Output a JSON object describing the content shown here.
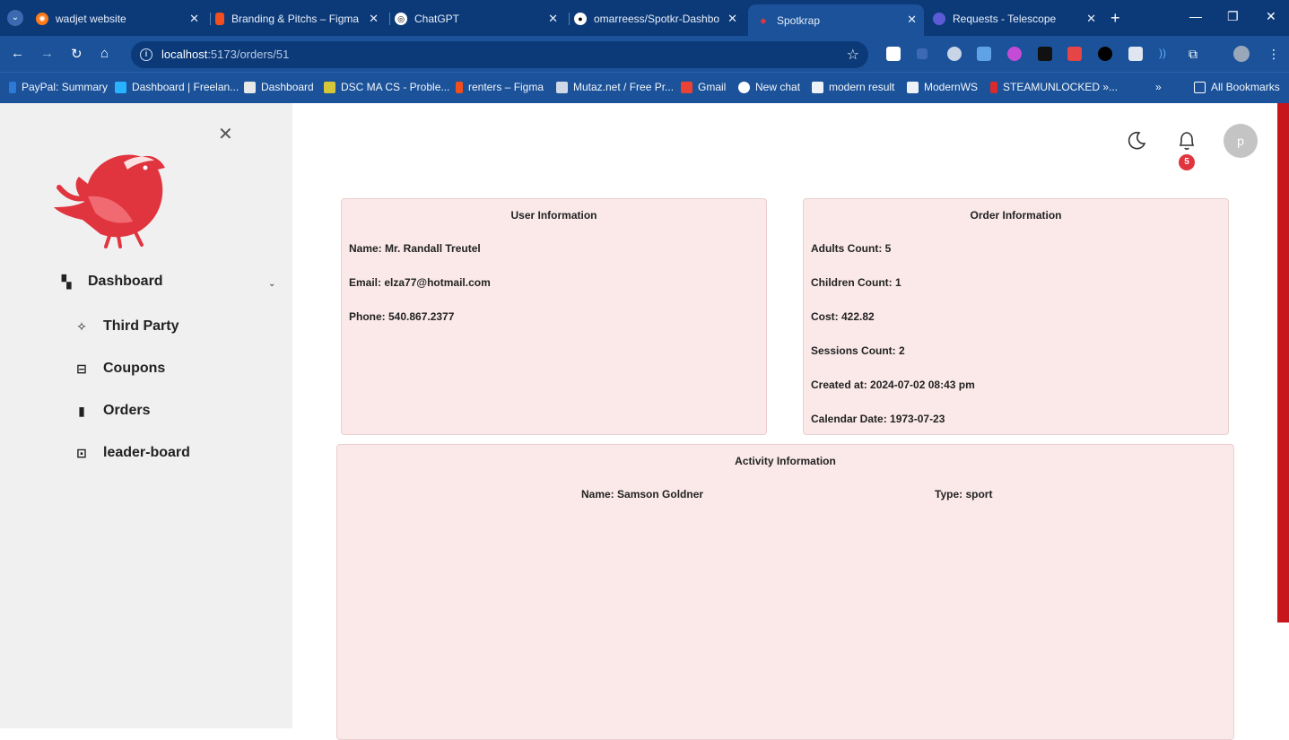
{
  "browser": {
    "tabs": [
      {
        "title": "wadjet website",
        "fav_color": "#ff7a18"
      },
      {
        "title": "Branding & Pitchs – Figma",
        "fav_color": "#f24e1e"
      },
      {
        "title": "ChatGPT",
        "fav_color": "#ffffff"
      },
      {
        "title": "omarreess/Spotkr-Dashbo",
        "fav_color": "#ffffff"
      },
      {
        "title": "Spotkrap",
        "fav_color": "#e0353f"
      },
      {
        "title": "Requests - Telescope",
        "fav_color": "#5b5bd6"
      }
    ],
    "url_host": "localhost",
    "url_rest": ":5173/orders/51",
    "bookmarks": [
      "PayPal: Summary",
      "Dashboard | Freelan...",
      "Dashboard",
      "DSC MA CS - Proble...",
      "renters – Figma",
      "Mutaz.net / Free Pr...",
      "Gmail",
      "New chat",
      "modern result",
      "ModernWS",
      "STEAMUNLOCKED »..."
    ],
    "all_bookmarks": "All Bookmarks",
    "overflow": "»"
  },
  "sidebar": {
    "items": [
      {
        "label": "Dashboard"
      },
      {
        "label": "Third Party"
      },
      {
        "label": "Coupons"
      },
      {
        "label": "Orders"
      },
      {
        "label": "leader-board"
      }
    ]
  },
  "header": {
    "notifications_count": "5",
    "avatar_initial": "p"
  },
  "user_info": {
    "title": "User Information",
    "name": "Name: Mr. Randall Treutel",
    "email": "Email: elza77@hotmail.com",
    "phone": "Phone: 540.867.2377"
  },
  "order_info": {
    "title": "Order Information",
    "adults": "Adults Count: 5",
    "children": "Children Count: 1",
    "cost": "Cost: 422.82",
    "sessions": "Sessions Count: 2",
    "created": "Created at: 2024-07-02 08:43 pm",
    "calendar": "Calendar Date: 1973-07-23"
  },
  "activity_info": {
    "title": "Activity Information",
    "name": "Name: Samson Goldner",
    "type": "Type: sport"
  },
  "colors": {
    "accent": "#e0353f",
    "card_bg": "#fbe9e9",
    "browser_dark": "#0c3a78",
    "browser": "#1b5299"
  }
}
